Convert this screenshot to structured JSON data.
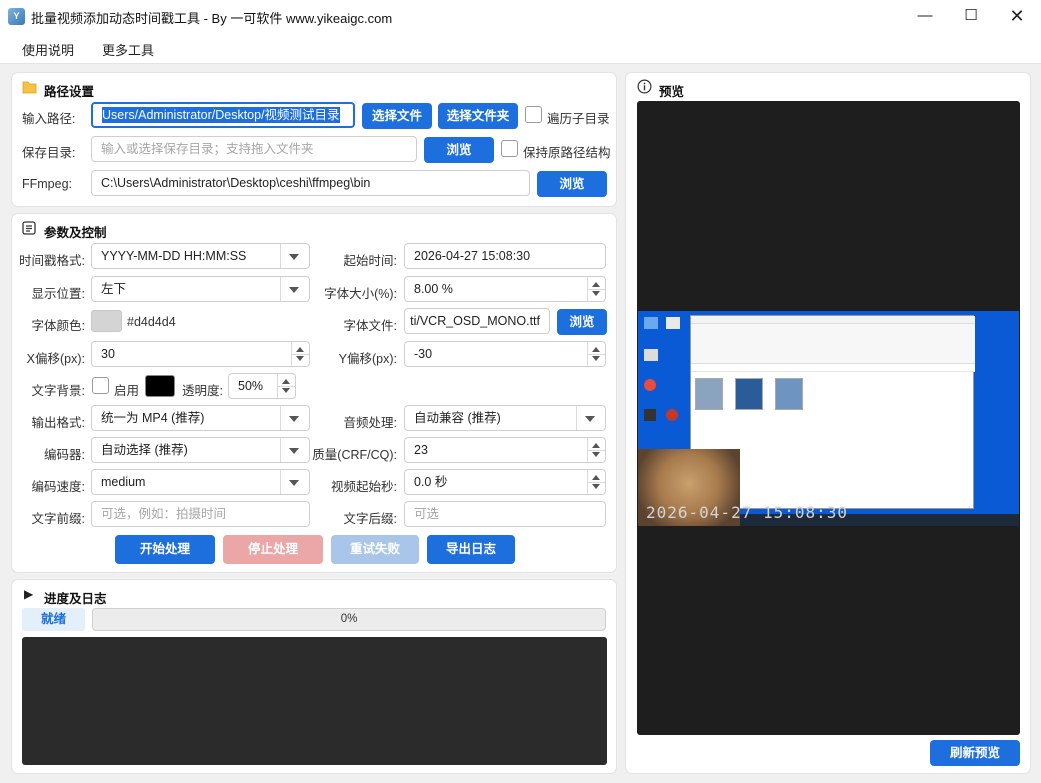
{
  "window": {
    "title": "批量视频添加动态时间戳工具 - By 一可软件 www.yikeaigc.com",
    "app_icon_text": "Y"
  },
  "menu": {
    "items": [
      "使用说明",
      "更多工具"
    ]
  },
  "path_section": {
    "title": "路径设置",
    "input_label": "输入路径:",
    "input_value": "Users/Administrator/Desktop/视频测试目录",
    "select_file": "选择文件",
    "select_folder": "选择文件夹",
    "recurse_label": "遍历子目录",
    "save_label": "保存目录:",
    "save_placeholder": "输入或选择保存目录；支持拖入文件夹",
    "browse": "浏览",
    "keep_structure_label": "保持原路径结构",
    "ffmpeg_label": "FFmpeg:",
    "ffmpeg_value": "C:\\Users\\Administrator\\Desktop\\ceshi\\ffmpeg\\bin",
    "ffmpeg_browse": "浏览"
  },
  "params_section": {
    "title": "参数及控制",
    "ts_format_label": "时间戳格式:",
    "ts_format_value": "YYYY-MM-DD HH:MM:SS",
    "start_time_label": "起始时间:",
    "start_time_value": "2026-04-27 15:08:30",
    "position_label": "显示位置:",
    "position_value": "左下",
    "font_size_label": "字体大小(%):",
    "font_size_value": "8.00 %",
    "font_color_label": "字体颜色:",
    "font_color_hex": "#d4d4d4",
    "font_file_label": "字体文件:",
    "font_file_value": "ti/VCR_OSD_MONO.ttf",
    "font_browse": "浏览",
    "x_offset_label": "X偏移(px):",
    "x_offset_value": "30",
    "y_offset_label": "Y偏移(px):",
    "y_offset_value": "-30",
    "bg_label": "文字背景:",
    "bg_enable_label": "启用",
    "bg_color": "#000000",
    "opacity_label": "透明度:",
    "opacity_value": "50%",
    "out_format_label": "输出格式:",
    "out_format_value": "统一为 MP4 (推荐)",
    "audio_label": "音频处理:",
    "audio_value": "自动兼容 (推荐)",
    "encoder_label": "编码器:",
    "encoder_value": "自动选择 (推荐)",
    "quality_label": "质量(CRF/CQ):",
    "quality_value": "23",
    "speed_label": "编码速度:",
    "speed_value": "medium",
    "video_start_label": "视频起始秒:",
    "video_start_value": "0.0 秒",
    "prefix_label": "文字前缀:",
    "prefix_placeholder": "可选，例如：拍摄时间",
    "suffix_label": "文字后缀:",
    "suffix_placeholder": "可选",
    "start_btn": "开始处理",
    "stop_btn": "停止处理",
    "retry_btn": "重试失败",
    "export_btn": "导出日志"
  },
  "progress_section": {
    "title": "进度及日志",
    "status": "就绪",
    "progress": "0%",
    "progress_value": 0
  },
  "preview_section": {
    "title": "预览",
    "timestamp_overlay": "2026-04-27 15:08:30",
    "refresh_btn": "刷新预览"
  },
  "colors": {
    "accent": "#1d6fde",
    "desktop_blue": "#0a5ad6"
  }
}
